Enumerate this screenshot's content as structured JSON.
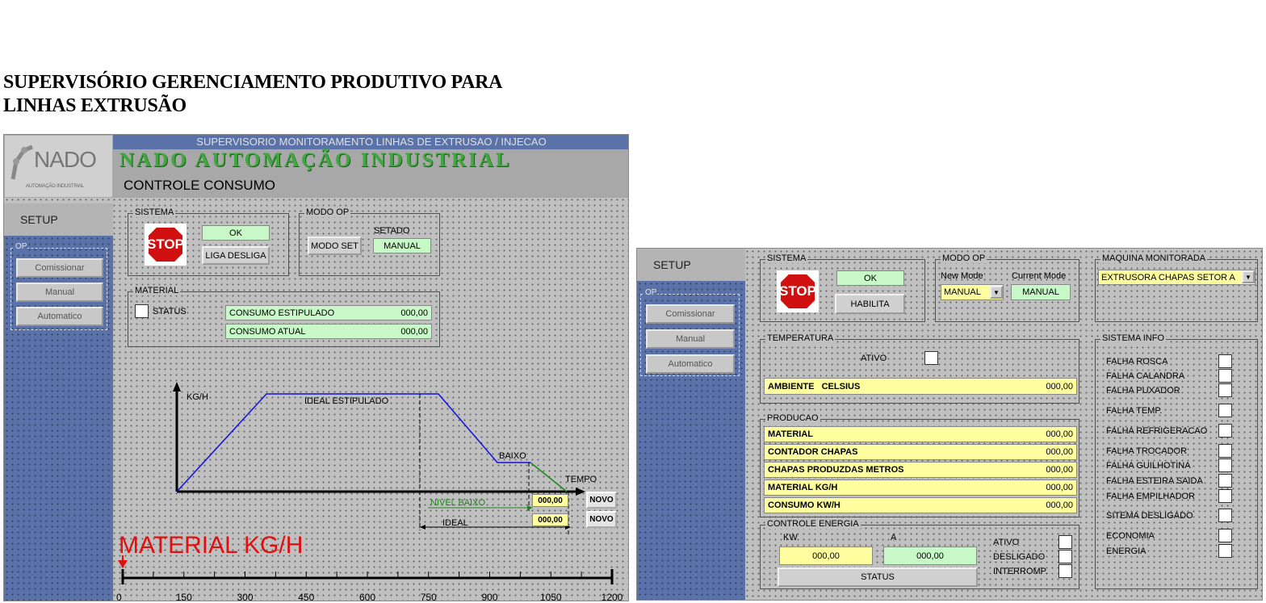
{
  "page_title": "SUPERVISÓRIO GERENCIAMENTO PRODUTIVO PARA\nLINHAS EXTRUSÃO",
  "left": {
    "header_banner": "SUPERVISORIO MONITORAMENTO LINHAS DE EXTRUSAO / INJECAO",
    "logo_text": "NADO",
    "logo_subtext": "AUTOMAÇÃO INDUSTRIAL",
    "company": "NADO AUTOMAÇÃO INDUSTRIAL",
    "screen_title": "CONTROLE CONSUMO",
    "setup": "SETUP",
    "op_label": "OP",
    "op_buttons": [
      "Comissionar",
      "Manual",
      "Automatico"
    ],
    "sistema": {
      "label": "SISTEMA",
      "stop": "STOP",
      "status": "OK",
      "button": "LIGA DESLIGA"
    },
    "modo_op": {
      "label": "MODO OP",
      "button": "MODO SET",
      "setado_label": "SETADO",
      "setado_value": "MANUAL"
    },
    "material": {
      "label": "MATERIAL",
      "status_label": "STATUS",
      "rows": [
        {
          "label": "CONSUMO ESTIPULADO",
          "value": "000,00"
        },
        {
          "label": "CONSUMO ATUAL",
          "value": "000,00"
        }
      ]
    },
    "graph": {
      "y_label": "KG/H",
      "x_label": "TEMPO",
      "ideal_label": "IDEAL ESTIPULADO",
      "baixo_label": "BAIXO",
      "nivel_baixo_label": "NIVEL BAIXO",
      "ideal_short_label": "IDEAL",
      "nivel_baixo_value": "000,00",
      "ideal_value": "000,00",
      "novo_buttons": [
        "NOVO",
        "NOVO"
      ]
    },
    "scale": {
      "title": "MATERIAL KG/H",
      "ticks": [
        "0",
        "150",
        "300",
        "450",
        "600",
        "750",
        "900",
        "1050",
        "1200"
      ],
      "marker_value": 0
    }
  },
  "right": {
    "setup": "SETUP",
    "op_label": "OP",
    "op_buttons": [
      "Comissionar",
      "Manual",
      "Automatico"
    ],
    "sistema": {
      "label": "SISTEMA",
      "stop": "STOP",
      "status": "OK",
      "button": "HABILITA"
    },
    "modo_op": {
      "label": "MODO OP",
      "new_mode_label": "New Mode",
      "current_mode_label": "Current Mode",
      "new_mode_value": "MANUAL",
      "current_mode_value": "MANUAL"
    },
    "maquina": {
      "label": "MAQUINA MONITORADA",
      "value": "EXTRUSORA CHAPAS SETOR A"
    },
    "temperatura": {
      "label": "TEMPERATURA",
      "ativo_label": "ATIVO",
      "row_label": "AMBIENTE   CELSIUS",
      "row_value": "000,00"
    },
    "producao": {
      "label": "PRODUCAO",
      "rows": [
        {
          "label": "MATERIAL",
          "value": "000,00"
        },
        {
          "label": "CONTADOR CHAPAS",
          "value": "000,00"
        },
        {
          "label": "CHAPAS PRODUZDAS METROS",
          "value": "000,00"
        },
        {
          "label": "MATERIAL KG/H",
          "value": "000,00"
        },
        {
          "label": "CONSUMO KW/H",
          "value": "000,00"
        }
      ]
    },
    "energia": {
      "label": "CONTROLE ENERGIA",
      "kw_label": "KW",
      "a_label": "A",
      "kw_value": "000,00",
      "a_value": "000,00",
      "status_button": "STATUS",
      "flags": [
        "ATIVO",
        "DESLIGADO",
        "INTERROMP."
      ]
    },
    "sistema_info": {
      "label": "SISTEMA INFO",
      "items": [
        "FALHA ROSCA",
        "FALHA CALANDRA",
        "FALHA PUXADOR",
        "FALHA TEMP.",
        "FALHA REFRIGERACAO",
        "FALHA TROCADOR",
        "FALHA GUILHOTINA",
        "FALHA ESTEIRA SAIDA",
        "FALHA EMPILHADOR",
        "SITEMA DESLIGADO",
        "ECONOMIA",
        "ENERGIA"
      ]
    }
  }
}
